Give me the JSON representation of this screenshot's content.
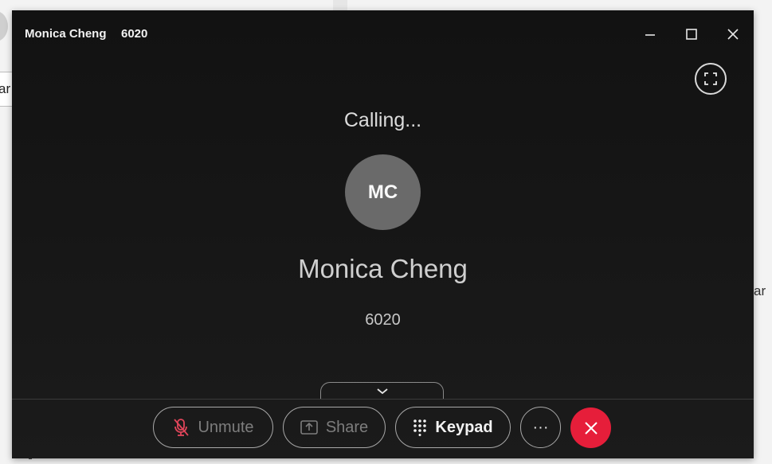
{
  "window": {
    "title_name": "Monica Cheng",
    "title_number": "6020",
    "buttons": {
      "minimize_icon": "minimize-icon",
      "maximize_icon": "maximize-icon",
      "close_icon": "close-icon"
    }
  },
  "call": {
    "status": "Calling...",
    "avatar_initials": "MC",
    "callee_name": "Monica Cheng",
    "callee_number": "6020"
  },
  "controls": {
    "unmute_label": "Unmute",
    "share_label": "Share",
    "keypad_label": "Keypad",
    "more_label": "···",
    "end_call_icon": "close-icon"
  },
  "background": {
    "input_fragment": "ar",
    "side_text": "ar"
  },
  "colors": {
    "window_bg": "#151515",
    "avatar_bg": "#6a6a6a",
    "end_call": "#e61e3a",
    "muted_icon": "#e0455a"
  }
}
